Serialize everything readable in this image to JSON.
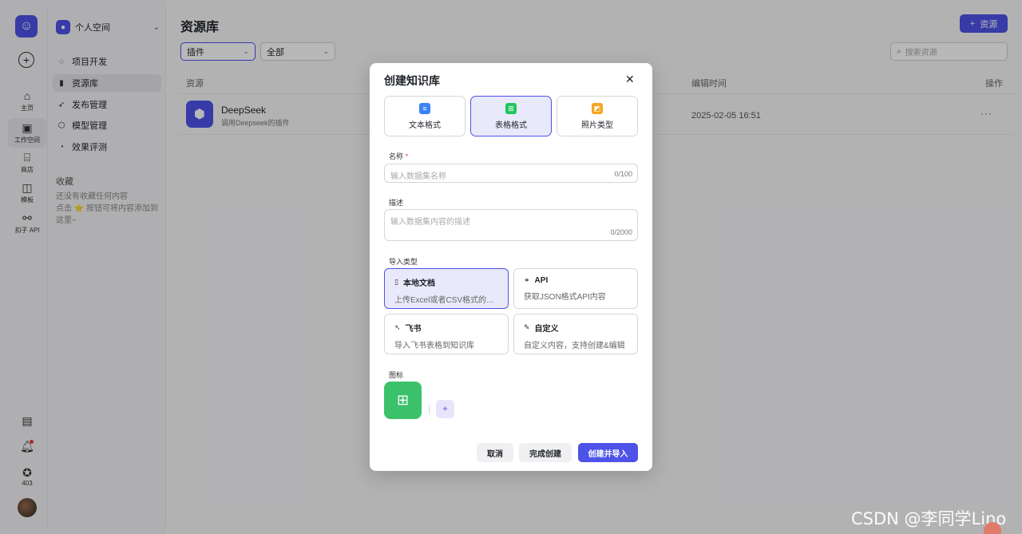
{
  "rail": {
    "items": [
      {
        "label": "主页",
        "icon": "home-icon"
      },
      {
        "label": "工作空间",
        "icon": "workspace-icon"
      },
      {
        "label": "商店",
        "icon": "store-icon"
      },
      {
        "label": "模板",
        "icon": "template-icon"
      },
      {
        "label": "扣子 API",
        "icon": "api-icon"
      }
    ],
    "bottom_count": "403"
  },
  "sidebar": {
    "space_name": "个人空间",
    "items": [
      {
        "label": "项目开发"
      },
      {
        "label": "资源库"
      },
      {
        "label": "发布管理"
      },
      {
        "label": "模型管理"
      },
      {
        "label": "效果评测"
      }
    ],
    "favorites_title": "收藏",
    "favorites_empty_line1": "还没有收藏任何内容",
    "favorites_empty_line2": "点击 ⭐ 按钮可将内容添加到这里~"
  },
  "main": {
    "title": "资源库",
    "add_button": "资源",
    "filter_type": "插件",
    "filter_scope": "全部",
    "search_placeholder": "搜索资源",
    "columns": {
      "resource": "资源",
      "edit_time": "编辑时间",
      "actions": "操作"
    },
    "rows": [
      {
        "name": "DeepSeek",
        "desc": "调用Deepseek的插件",
        "time": "2025-02-05 16:51",
        "more": "···"
      }
    ]
  },
  "modal": {
    "title": "创建知识库",
    "formats": [
      {
        "label": "文本格式",
        "color": "#3b82f6"
      },
      {
        "label": "表格格式",
        "color": "#22c55e"
      },
      {
        "label": "照片类型",
        "color": "#f5a623"
      }
    ],
    "name_label": "名称",
    "name_placeholder": "输入数据集名称",
    "name_count": "0/100",
    "desc_label": "描述",
    "desc_placeholder": "输入数据集内容的描述",
    "desc_count": "0/2000",
    "import_label": "导入类型",
    "imports": [
      {
        "title": "本地文档",
        "desc": "上传Excel或者CSV格式的文档"
      },
      {
        "title": "API",
        "desc": "获取JSON格式API内容"
      },
      {
        "title": "飞书",
        "desc": "导入飞书表格到知识库"
      },
      {
        "title": "自定义",
        "desc": "自定义内容，支持创建&编辑"
      }
    ],
    "icon_label": "图标",
    "buttons": {
      "cancel": "取消",
      "finish": "完成创建",
      "create_import": "创建并导入"
    }
  },
  "watermark": "CSDN @李同学Lino",
  "colors": {
    "accent": "#4d53e8",
    "green": "#3cc16b"
  }
}
